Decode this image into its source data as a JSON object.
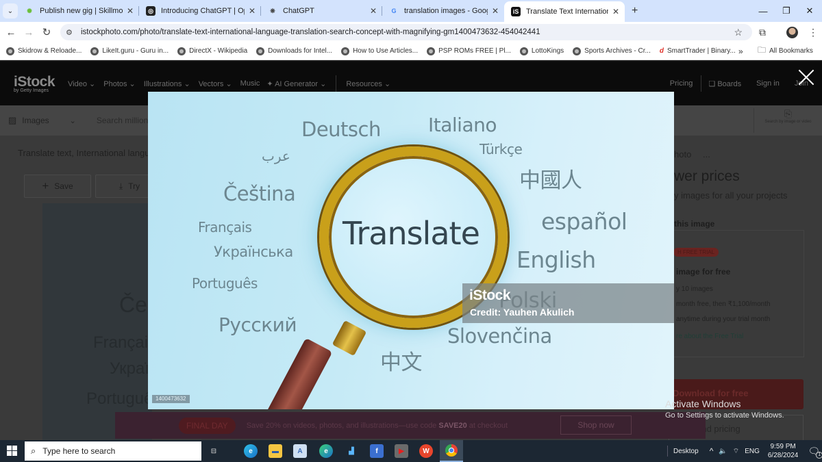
{
  "browser": {
    "tabs": [
      {
        "title": "Publish new gig | Skillmonde",
        "icon": "skillmonde-icon",
        "active": false
      },
      {
        "title": "Introducing ChatGPT | OpenAI",
        "icon": "openai-icon",
        "active": false
      },
      {
        "title": "ChatGPT",
        "icon": "chatgpt-icon",
        "active": false
      },
      {
        "title": "translation images - Google Se",
        "icon": "google-icon",
        "active": false
      },
      {
        "title": "Translate Text International Lan",
        "icon": "istock-icon",
        "active": true
      }
    ],
    "url": "istockphoto.com/photo/translate-text-international-language-translation-search-concept-with-magnifying-gm1400473632-454042441",
    "bookmarks": [
      "Skidrow & Reloade...",
      "LikeIt.guru - Guru in...",
      "DirectX - Wikipedia",
      "Downloads for Intel...",
      "How to Use Articles...",
      "PSP ROMs FREE | Pl...",
      "LottoKings",
      "Sports Archives - Cr...",
      "SmartTrader | Binary..."
    ],
    "all_bookmarks_label": "All Bookmarks"
  },
  "site": {
    "logo": "iStock",
    "logo_sub": "by Getty Images",
    "nav": [
      "Video",
      "Photos",
      "Illustrations",
      "Vectors",
      "Music",
      "AI Generator",
      "Resources"
    ],
    "header_right": {
      "pricing": "Pricing",
      "boards": "Boards",
      "sign_in": "Sign in",
      "join": "Join"
    },
    "search": {
      "type_label": "Images",
      "placeholder": "Search millions of royalty-free stock images and videos",
      "visual_search_label": "Search by image or video"
    },
    "page_title": "Translate text, International language translation search concept with magnifying",
    "save_label": "Save",
    "try_label": "Try",
    "bg_words": [
      "Češ",
      "Françai",
      "Украї",
      "Portuguê"
    ],
    "right_panel": {
      "photo_tab": "hoto",
      "more": "...",
      "heading": "wer prices",
      "subheading": "y images for all your projects",
      "this_image": "this image",
      "trial_badge": "H FREE TRIAL",
      "image_free": "image for free",
      "bullets": [
        "y 10 images",
        "month free, then ₹1,100/month",
        "anytime during your trial month"
      ],
      "more_link": "re about the Free Trial",
      "download_btn": "Download for free",
      "plans_btn": "s and pricing"
    },
    "promo": {
      "badge": "FINAL DAY",
      "text_before": "Save 20% on videos, photos, and illustrations—use code ",
      "code": "SAVE20",
      "text_after": " at checkout",
      "button": "Shop now"
    }
  },
  "modal": {
    "words": {
      "deutsch": "Deutsch",
      "arabic": "عرب",
      "cestina": "Čeština",
      "francais": "Français",
      "ukrainian": "Українська",
      "portugues": "Português",
      "russian": "Русский",
      "italiano": "Italiano",
      "turkce": "Türkçe",
      "chinese_trad": "中國人",
      "espanol": "español",
      "english": "English",
      "polski": "Polski",
      "slovencina": "Slovenčina",
      "chinese": "中文",
      "translate": "Translate"
    },
    "watermark_brand": "iStock",
    "credit": "Credit: Yauhen Akulich",
    "image_id": "1400473632"
  },
  "windows": {
    "activate_title": "Activate Windows",
    "activate_sub": "Go to Settings to activate Windows.",
    "search_placeholder": "Type here to search",
    "desktop_label": "Desktop",
    "language": "ENG",
    "time": "9:59 PM",
    "date": "6/28/2024",
    "notification_count": "1"
  }
}
